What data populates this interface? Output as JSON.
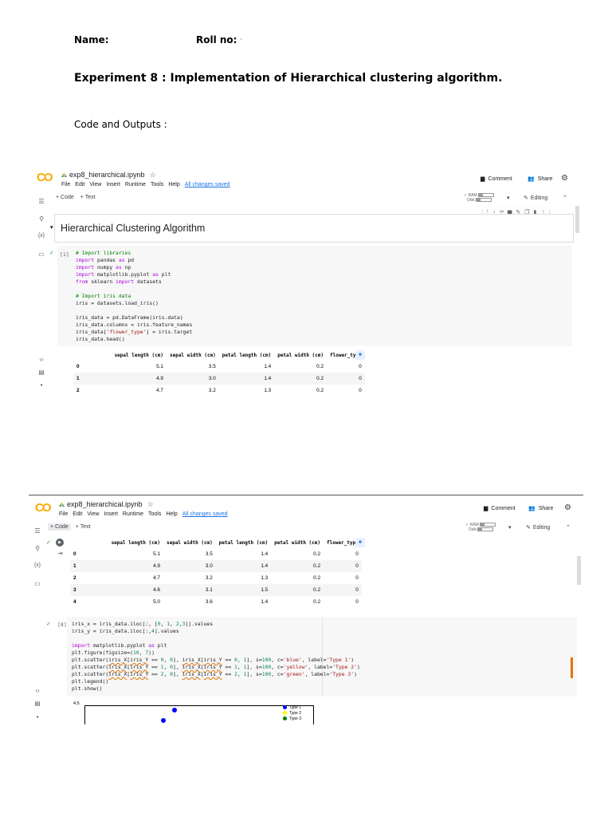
{
  "doc": {
    "name_label": "Name:",
    "roll_label": "Roll no:",
    "roll_value": "'",
    "experiment_title": "Experiment 8 : Implementation of Hierarchical clustering algorithm.",
    "code_outputs_label": "Code and Outputs :"
  },
  "colab": {
    "logo": "CO",
    "filename": "exp8_hierarchical.ipynb",
    "menu": [
      "File",
      "Edit",
      "View",
      "Insert",
      "Runtime",
      "Tools",
      "Help"
    ],
    "saved_status": "All changes saved",
    "comment_label": "Comment",
    "share_label": "Share",
    "add_code": "+ Code",
    "add_text": "+ Text",
    "ram_label": "RAM",
    "disk_label": "Disk",
    "editing_label": "Editing",
    "section_heading": "Hierarchical Clustering Algorithm",
    "cell1_prompt": "[1]",
    "cell2_prompt": "[8]",
    "table": {
      "columns": [
        "sepal length (cm)",
        "sepal width (cm)",
        "petal length (cm)",
        "petal width (cm)",
        "flower_type"
      ],
      "rows": [
        [
          "0",
          "5.1",
          "3.5",
          "1.4",
          "0.2",
          "0"
        ],
        [
          "1",
          "4.9",
          "3.0",
          "1.4",
          "0.2",
          "0"
        ],
        [
          "2",
          "4.7",
          "3.2",
          "1.3",
          "0.2",
          "0"
        ],
        [
          "3",
          "4.6",
          "3.1",
          "1.5",
          "0.2",
          "0"
        ],
        [
          "4",
          "5.0",
          "3.6",
          "1.4",
          "0.2",
          "0"
        ]
      ]
    },
    "plot": {
      "ytick_top": "4.5",
      "legend": [
        {
          "label": "Type 1",
          "color": "#0000ff"
        },
        {
          "label": "Type 2",
          "color": "#ffff00"
        },
        {
          "label": "Type 3",
          "color": "#008000"
        }
      ]
    }
  }
}
